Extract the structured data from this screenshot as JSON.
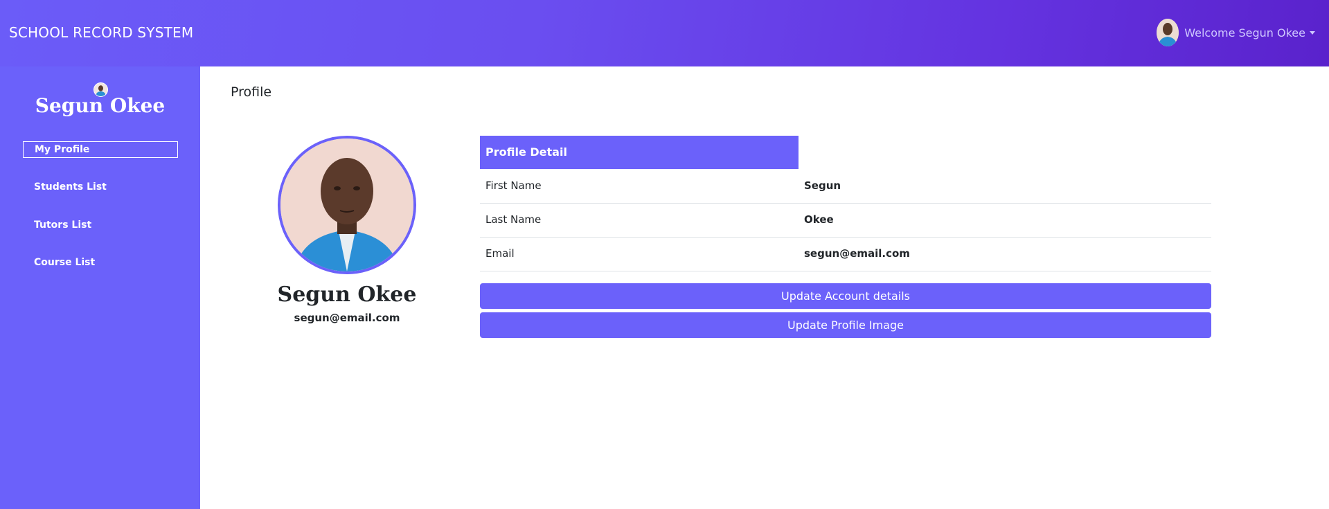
{
  "header": {
    "brand": "SCHOOL RECORD SYSTEM",
    "welcome": "Welcome Segun Okee",
    "avatar_icon": "user-avatar-icon"
  },
  "sidebar": {
    "name": "Segun Okee",
    "items": [
      {
        "label": "My Profile",
        "active": true
      },
      {
        "label": "Students List",
        "active": false
      },
      {
        "label": "Tutors List",
        "active": false
      },
      {
        "label": "Course List",
        "active": false
      }
    ]
  },
  "main": {
    "title": "Profile",
    "profile": {
      "name": "Segun Okee",
      "email": "segun@email.com"
    },
    "detail": {
      "header": "Profile Detail",
      "rows": [
        {
          "label": "First Name",
          "value": "Segun"
        },
        {
          "label": "Last Name",
          "value": "Okee"
        },
        {
          "label": "Email",
          "value": "segun@email.com"
        }
      ]
    },
    "buttons": {
      "update_account": "Update Account details",
      "update_image": "Update Profile Image"
    }
  },
  "colors": {
    "accent": "#6b61fa",
    "header_start": "#6b5cf8",
    "header_end": "#5a22cc"
  }
}
